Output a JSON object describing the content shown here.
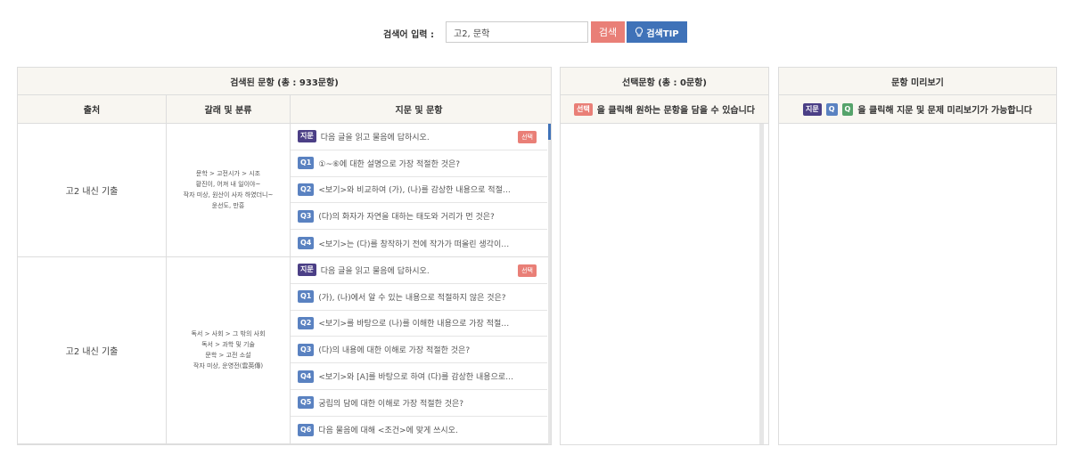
{
  "search": {
    "label": "검색어 입력 :",
    "value": "고2, 문학",
    "button": "검색",
    "tip_button": "검색TIP"
  },
  "results_panel": {
    "title": "검색된 문항 (총 : 933문항)",
    "columns": [
      "출처",
      "갈래 및 분류",
      "지문 및 문항"
    ],
    "select_label": "선택",
    "groups": [
      {
        "source": "고2 내신 기출",
        "classification": [
          "문학 > 고전시가 > 시조",
          "황진이, 어져 내 일이야~",
          "작자 미상, 원산이 사자 하였더니~",
          "윤선도, 만흥"
        ],
        "passage_tag": "지문",
        "passage": "다음 글을 읽고 물음에 답하시오.",
        "questions": [
          {
            "tag": "Q1",
            "text": "①~⑥에 대한 설명으로 가장 적절한 것은?"
          },
          {
            "tag": "Q2",
            "text": "<보기>와 비교하여 (가), (나)를 감상한 내용으로 적절…"
          },
          {
            "tag": "Q3",
            "text": "(다)의 화자가 자연을 대하는 태도와 거리가 먼 것은?"
          },
          {
            "tag": "Q4",
            "text": "<보기>는 (다)를 창작하기 전에 작가가 떠올린 생각이…"
          }
        ]
      },
      {
        "source": "고2 내신 기출",
        "classification": [
          "독서 > 사회 > 그 밖의 사회",
          "독서 > 과학 및 기술",
          "문학 > 고전 소설",
          "작자 미상, 운영전(雲英傳)"
        ],
        "passage_tag": "지문",
        "passage": "다음 글을 읽고 물음에 답하시오.",
        "questions": [
          {
            "tag": "Q1",
            "text": "(가), (나)에서 알 수 있는 내용으로 적절하지 않은 것은?"
          },
          {
            "tag": "Q2",
            "text": "<보기>를 바탕으로 (나)를 이해한 내용으로 가장 적절…"
          },
          {
            "tag": "Q3",
            "text": "(다)의 내용에 대한 이해로 가장 적절한 것은?"
          },
          {
            "tag": "Q4",
            "text": "<보기>와 [A]를 바탕으로 하여 (다)를 감상한 내용으로 …"
          },
          {
            "tag": "Q5",
            "text": "궁립의 담에 대한 이해로 가장 적절한 것은?"
          },
          {
            "tag": "Q6",
            "text": "다음 물음에 대해 <조건>에 맞게 쓰시오."
          }
        ]
      }
    ]
  },
  "selected_panel": {
    "title": "선택문항 (총 : 0문항)",
    "hint_tag": "선택",
    "hint": "을 클릭해 원하는 문항을 담을 수 있습니다"
  },
  "preview_panel": {
    "title": "문항 미리보기",
    "hint_tags": [
      "지문",
      "Q",
      "Q"
    ],
    "hint": "을 클릭해 지문 및 문제 미리보기가 가능합니다"
  },
  "colors": {
    "accent_blue": "#3f72b8",
    "accent_red": "#e97f77",
    "passage_tag": "#4b3f86",
    "question_tag": "#5a82c1",
    "header_bg": "#f8f6f1"
  }
}
